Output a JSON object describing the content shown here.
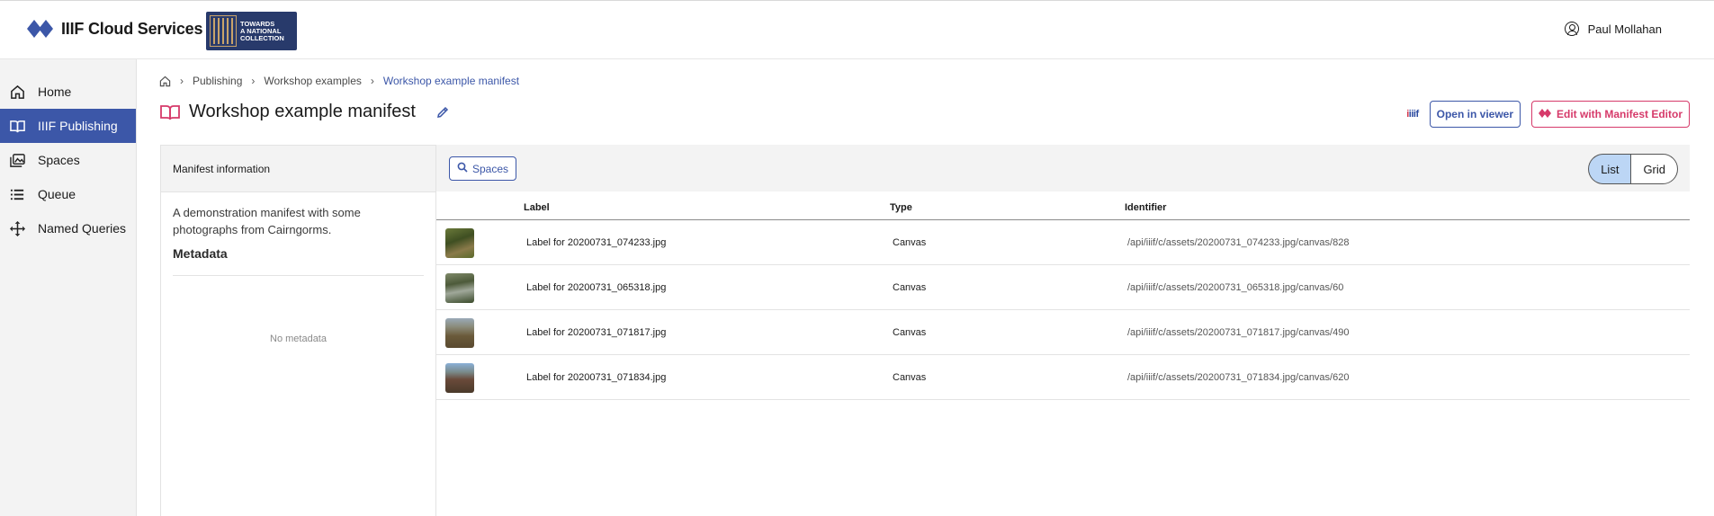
{
  "header": {
    "brand_name": "IIIF Cloud Services",
    "partner_lines": [
      "TOWARDS",
      "A NATIONAL",
      "COLLECTION"
    ],
    "user_name": "Paul Mollahan"
  },
  "sidebar": {
    "items": [
      {
        "label": "Home",
        "icon": "home-icon",
        "active": false
      },
      {
        "label": "IIIF Publishing",
        "icon": "book-icon",
        "active": true
      },
      {
        "label": "Spaces",
        "icon": "spaces-icon",
        "active": false
      },
      {
        "label": "Queue",
        "icon": "list-icon",
        "active": false
      },
      {
        "label": "Named Queries",
        "icon": "move-icon",
        "active": false
      }
    ]
  },
  "breadcrumb": {
    "items": [
      "Publishing",
      "Workshop examples"
    ],
    "current": "Workshop example manifest"
  },
  "page": {
    "title": "Workshop example manifest",
    "iiif_badge": "iiif",
    "open_viewer_label": "Open in viewer",
    "edit_label": "Edit with Manifest Editor"
  },
  "info_panel": {
    "heading": "Manifest information",
    "description": "A demonstration manifest with some photographs from Cairngorms.",
    "metadata_heading": "Metadata",
    "no_metadata": "No metadata"
  },
  "toolbar": {
    "spaces_label": "Spaces",
    "view_list": "List",
    "view_grid": "Grid",
    "active_view": "List"
  },
  "table": {
    "columns": [
      "Label",
      "Type",
      "Identifier"
    ],
    "rows": [
      {
        "label": "Label for 20200731_074233.jpg",
        "type": "Canvas",
        "identifier": "/api/iiif/c/assets/20200731_074233.jpg/canvas/828"
      },
      {
        "label": "Label for 20200731_065318.jpg",
        "type": "Canvas",
        "identifier": "/api/iiif/c/assets/20200731_065318.jpg/canvas/60"
      },
      {
        "label": "Label for 20200731_071817.jpg",
        "type": "Canvas",
        "identifier": "/api/iiif/c/assets/20200731_071817.jpg/canvas/490"
      },
      {
        "label": "Label for 20200731_071834.jpg",
        "type": "Canvas",
        "identifier": "/api/iiif/c/assets/20200731_071834.jpg/canvas/620"
      }
    ]
  },
  "colors": {
    "primary": "#3c57a8",
    "accent_pink": "#d63a6a",
    "sidebar_bg": "#f3f3f3",
    "toggle_active": "#bcd6f5"
  }
}
